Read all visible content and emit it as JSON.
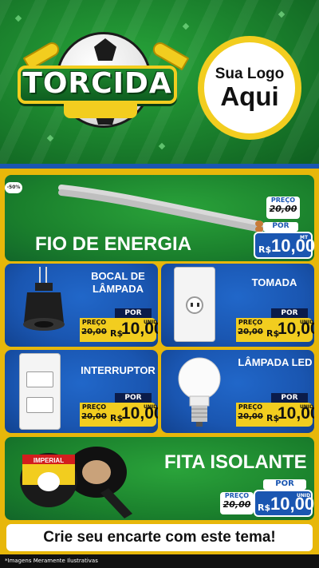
{
  "header": {
    "brand": "TORCIDA",
    "logo_line1": "Sua Logo",
    "logo_line2": "Aqui",
    "colors": {
      "green": "#1a7f2c",
      "yellow": "#f2cd1f",
      "blue": "#1a56b1"
    }
  },
  "hero": {
    "badge": "-50%",
    "title": "FIO DE ENERGIA",
    "price": {
      "label": "PREÇO",
      "old": "20,00",
      "por": "POR",
      "currency": "R$",
      "value": "10,00",
      "unit": "MT"
    },
    "icon": "wire-icon"
  },
  "grid": [
    {
      "title": "BOCAL DE LÂMPADA",
      "icon": "lamp-socket-icon",
      "price": {
        "label": "PREÇO",
        "old": "20,00",
        "por": "POR",
        "currency": "R$",
        "value": "10,00",
        "unit": "UNID"
      }
    },
    {
      "title": "TOMADA",
      "icon": "outlet-icon",
      "price": {
        "label": "PREÇO",
        "old": "20,00",
        "por": "POR",
        "currency": "R$",
        "value": "10,00",
        "unit": "UNID"
      }
    },
    {
      "title": "INTERRUPTOR",
      "icon": "switch-icon",
      "price": {
        "label": "PREÇO",
        "old": "20,00",
        "por": "POR",
        "currency": "R$",
        "value": "10,00",
        "unit": "UNID"
      }
    },
    {
      "title": "LÂMPADA LED",
      "icon": "led-bulb-icon",
      "price": {
        "label": "PREÇO",
        "old": "20,00",
        "por": "POR",
        "currency": "R$",
        "value": "10,00",
        "unit": "UNID"
      }
    }
  ],
  "tape": {
    "title": "FITA ISOLANTE",
    "brand_text": "IMPERIAL",
    "icon": "tape-roll-icon",
    "price": {
      "label": "PREÇO",
      "old": "20,00",
      "por": "POR",
      "currency": "R$",
      "value": "10,00",
      "unit": "UNID"
    }
  },
  "footer": {
    "cta": "Crie seu encarte com este tema!",
    "disclaimer": "*Imagens Meramente Ilustrativas"
  }
}
